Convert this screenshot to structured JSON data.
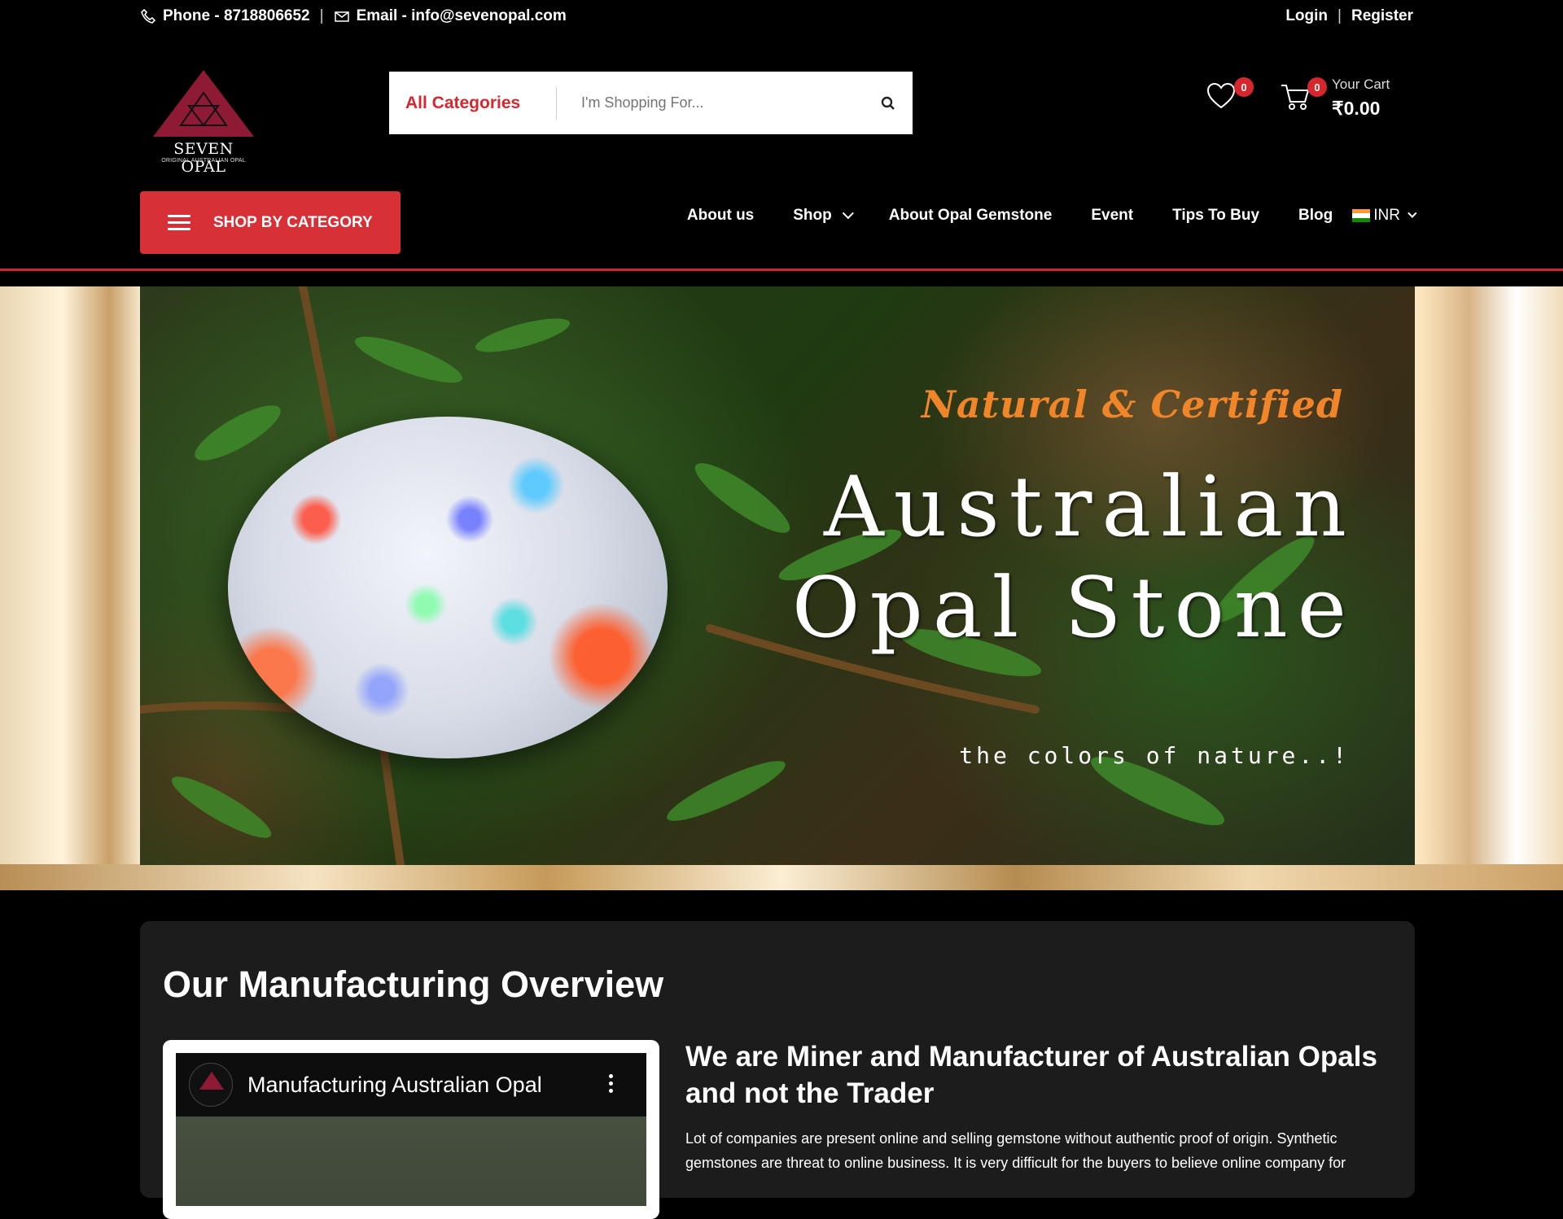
{
  "topbar": {
    "phone": "Phone - 8718806652",
    "separator": "|",
    "email": "Email - info@sevenopal.com",
    "login": "Login",
    "register": "Register"
  },
  "logo": {
    "brand": "SEVEN OPAL",
    "tagline": "ORIGINAL AUSTRALIAN OPAL",
    "color": "#8e1a35"
  },
  "search": {
    "category": "All Categories",
    "placeholder": "I'm Shopping For..."
  },
  "header": {
    "wishlist_count": "0",
    "cart_count": "0",
    "cart_label": "Your Cart",
    "cart_amount": "₹0.00"
  },
  "nav": {
    "shop_by_category": "SHOP BY CATEGORY",
    "items": [
      "About us",
      "Shop",
      "About Opal Gemstone",
      "Event",
      "Tips To Buy",
      "Blog"
    ],
    "currency": "INR"
  },
  "banner": {
    "kicker": "Natural & Certified",
    "title_line1": "Australian",
    "title_line2": "Opal Stone",
    "subtitle": "the colors of nature..!"
  },
  "overview": {
    "heading": "Our Manufacturing Overview",
    "video_title": "Manufacturing Australian Opal",
    "about_heading": "We are Miner and Manufacturer of Australian Opals and not the Trader",
    "about_text": "Lot of companies are present online and selling gemstone without authentic proof of origin. Synthetic gemstones are threat to online business. It is very difficult for the buyers to believe online company for"
  },
  "colors": {
    "accent": "#d83037",
    "banner_kicker": "#f0852a",
    "page_bg": "#000000",
    "card_bg": "#1c1c1c"
  }
}
